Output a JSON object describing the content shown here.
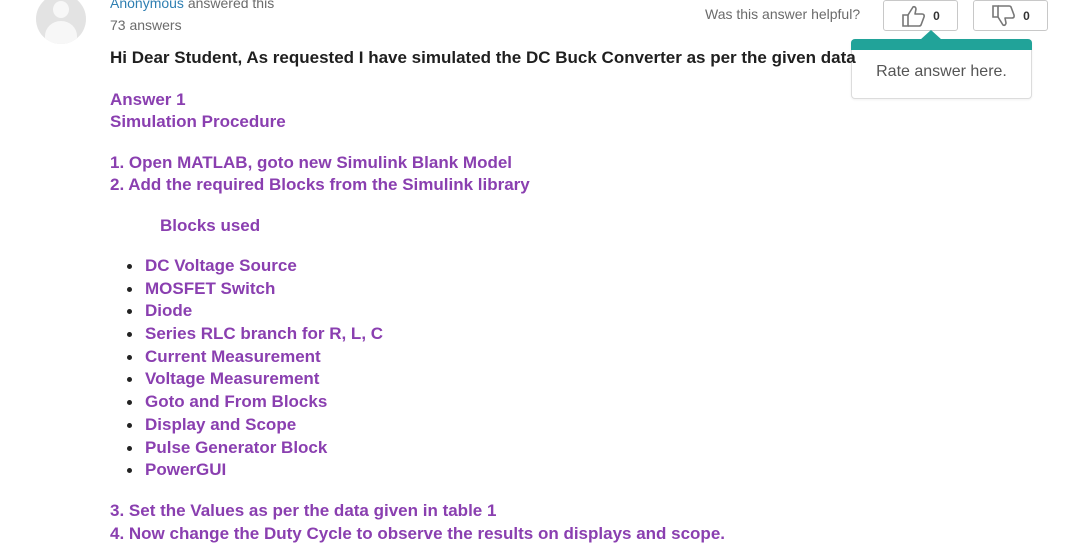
{
  "author": {
    "name": "Anonymous",
    "action": " answered this",
    "answers_count": "73 answers"
  },
  "feedback": {
    "question": "Was this answer helpful?",
    "upvote_count": "0",
    "downvote_count": "0",
    "tooltip": "Rate answer here."
  },
  "answer": {
    "intro": "Hi Dear Student, As requested I have simulated the DC Buck Converter as per the given data",
    "heading": "Answer 1",
    "subheading": "Simulation Procedure",
    "step1": "1. Open MATLAB, goto new Simulink Blank Model",
    "step2": "2. Add the required Blocks from the Simulink library",
    "blocks_title": "Blocks used",
    "blocks": [
      "DC Voltage Source",
      "MOSFET Switch",
      "Diode",
      "Series RLC branch for R, L, C",
      "Current Measurement",
      "Voltage Measurement",
      "Goto and From Blocks",
      "Display and Scope",
      "Pulse Generator Block",
      "PowerGUI"
    ],
    "step3": "3. Set the Values as per the data given in table 1",
    "step4": "4. Now change the Duty Cycle to observe the results on displays and scope."
  },
  "colors": {
    "accent": "#21a399",
    "text_purple": "#8a3fb0",
    "link": "#2f7fb2"
  }
}
